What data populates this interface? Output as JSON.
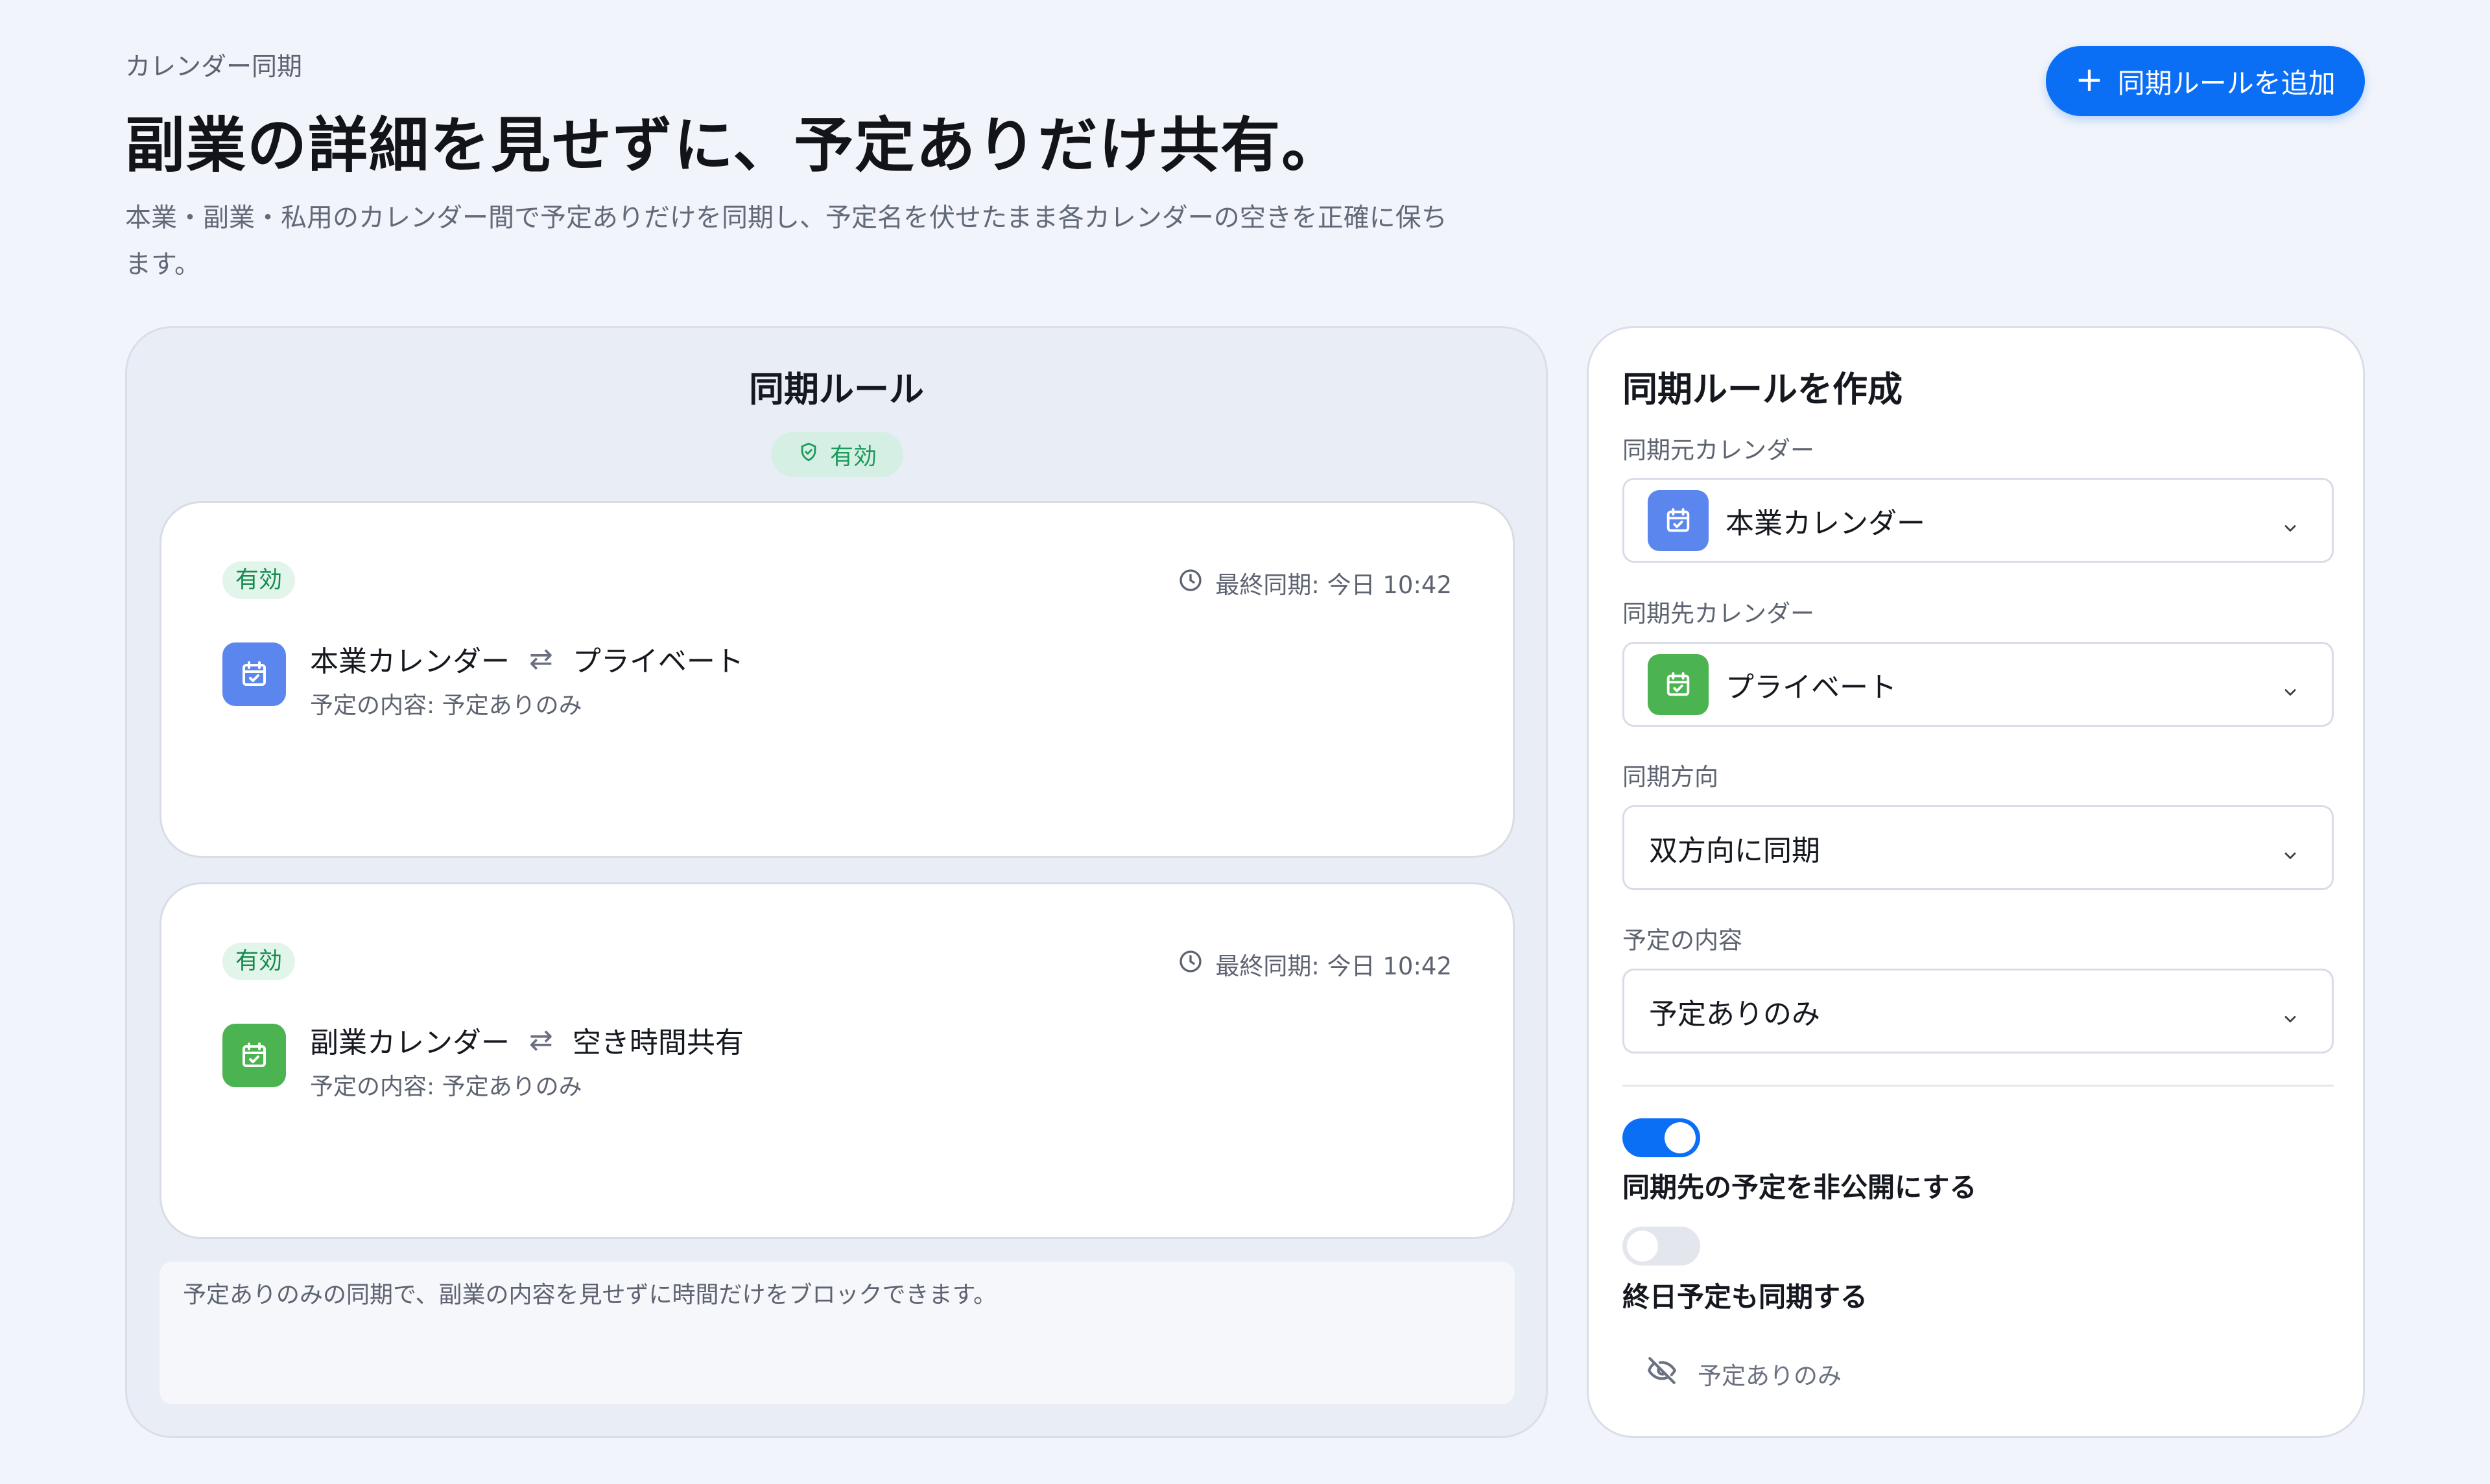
{
  "header": {
    "eyebrow": "カレンダー同期",
    "title": "副業の詳細を見せずに、予定ありだけ共有。",
    "description": "本業・副業・私用のカレンダー間で予定ありだけを同期し、予定名を伏せたまま各カレンダーの空きを正確に保ちます。",
    "add_button_label": "同期ルールを追加"
  },
  "rules_panel": {
    "title": "同期ルール",
    "status_label": "有効",
    "rules": [
      {
        "badge": "有効",
        "last_sync": "最終同期: 今日 10:42",
        "source": "本業カレンダー",
        "target": "プライベート",
        "content": "予定の内容: 予定ありのみ",
        "icon": "calendar-check-icon",
        "color": "#5b86ee"
      },
      {
        "badge": "有効",
        "last_sync": "最終同期: 今日 10:42",
        "source": "副業カレンダー",
        "target": "空き時間共有",
        "content": "予定の内容: 予定ありのみ",
        "icon": "calendar-check-icon",
        "color": "#4bb34f"
      }
    ],
    "note": "予定ありのみの同期で、副業の内容を見せずに時間だけをブロックできます。"
  },
  "form": {
    "title": "同期ルールを作成",
    "source_label": "同期元カレンダー",
    "source_value": "本業カレンダー",
    "target_label": "同期先カレンダー",
    "target_value": "プライベート",
    "direction_label": "同期方向",
    "direction_value": "双方向に同期",
    "content_label": "予定の内容",
    "content_value": "予定ありのみ",
    "toggle_private_label": "同期先の予定を非公開にする",
    "toggle_private_on": true,
    "toggle_allday_label": "終日予定も同期する",
    "toggle_allday_on": false,
    "preview_label": "予定ありのみ",
    "preview_icon": "eye-off-icon"
  },
  "colors": {
    "accent": "#0b6ff5",
    "active_green": "#168a4f",
    "calendar_blue": "#5b86ee",
    "calendar_green": "#4bb34f"
  }
}
